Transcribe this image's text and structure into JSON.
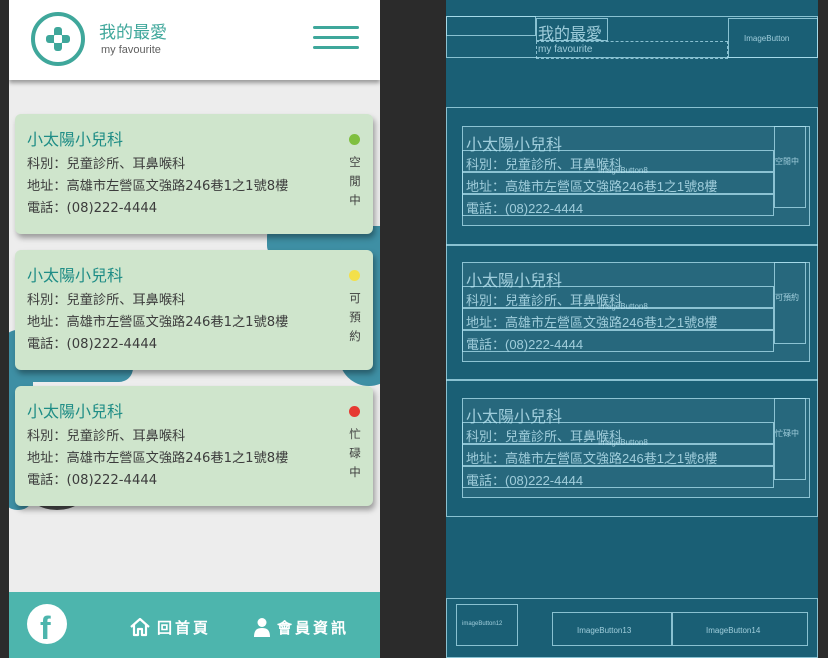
{
  "header": {
    "logo_icon": "medical-cross-icon",
    "title": "我的最愛",
    "subtitle": "my favourite",
    "menu_icon": "hamburger-menu-icon"
  },
  "clinics": [
    {
      "name": "小太陽小兒科",
      "department": "科別：兒童診所、耳鼻喉科",
      "address": "地址：高雄市左營區文強路246巷1之1號8樓",
      "phone": "電話：(08)222-4444",
      "status": "空閒中",
      "status_color": "#7fbf3f"
    },
    {
      "name": "小太陽小兒科",
      "department": "科別：兒童診所、耳鼻喉科",
      "address": "地址：高雄市左營區文強路246巷1之1號8樓",
      "phone": "電話：(08)222-4444",
      "status": "可預約",
      "status_color": "#f3e04a"
    },
    {
      "name": "小太陽小兒科",
      "department": "科別：兒童診所、耳鼻喉科",
      "address": "地址：高雄市左營區文強路246巷1之1號8樓",
      "phone": "電話：(08)222-4444",
      "status": "忙碌中",
      "status_color": "#e63a32"
    }
  ],
  "footer": {
    "facebook_icon": "facebook-icon",
    "home_label": "回首頁",
    "home_icon": "home-icon",
    "member_label": "會員資訊",
    "member_icon": "user-icon",
    "accent_color": "#4db5ad"
  },
  "blueprint": {
    "title": "我的最愛",
    "subtitle": "my favourite",
    "menu_button_label": "ImageButton",
    "cards": [
      {
        "name": "小太陽小兒科",
        "department": "科別：兒童診所、耳鼻喉科",
        "address": "地址：高雄市左營區文強路246巷1之1號8樓",
        "phone": "電話：(08)222-4444",
        "overlay_label": "ImageButton8",
        "status": "空閒中"
      },
      {
        "name": "小太陽小兒科",
        "department": "科別：兒童診所、耳鼻喉科",
        "address": "地址：高雄市左營區文強路246巷1之1號8樓",
        "phone": "電話：(08)222-4444",
        "overlay_label": "ImageButton8",
        "status": "可預約"
      },
      {
        "name": "小太陽小兒科",
        "department": "科別：兒童診所、耳鼻喉科",
        "address": "地址：高雄市左營區文強路246巷1之1號8樓",
        "phone": "電話：(08)222-4444",
        "overlay_label": "ImageButton8",
        "status": "忙碌中"
      }
    ],
    "footer_button_1": "imageButton12",
    "footer_button_2": "ImageButton13",
    "footer_button_3": "ImageButton14"
  }
}
